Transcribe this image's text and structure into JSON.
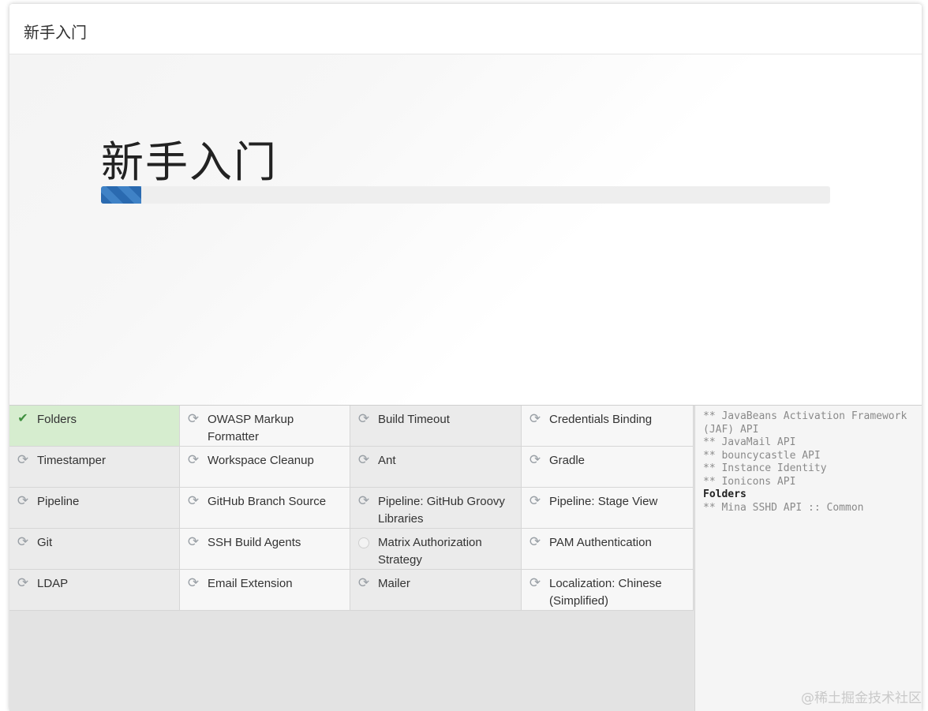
{
  "window": {
    "title": "新手入门"
  },
  "hero": {
    "title": "新手入门",
    "progress_fraction": 0.055,
    "progress_color": "#2a6ab0"
  },
  "plugins": [
    {
      "label": "Folders",
      "status": "success",
      "icon": "check-icon"
    },
    {
      "label": "OWASP Markup Formatter",
      "status": "installing",
      "icon": "sync-icon"
    },
    {
      "label": "Build Timeout",
      "status": "installing",
      "icon": "sync-icon"
    },
    {
      "label": "Credentials Binding",
      "status": "installing",
      "icon": "sync-icon"
    },
    {
      "label": "Timestamper",
      "status": "installing",
      "icon": "sync-icon"
    },
    {
      "label": "Workspace Cleanup",
      "status": "installing",
      "icon": "sync-icon"
    },
    {
      "label": "Ant",
      "status": "installing",
      "icon": "sync-icon"
    },
    {
      "label": "Gradle",
      "status": "installing",
      "icon": "sync-icon"
    },
    {
      "label": "Pipeline",
      "status": "installing",
      "icon": "sync-icon"
    },
    {
      "label": "GitHub Branch Source",
      "status": "installing",
      "icon": "sync-icon"
    },
    {
      "label": "Pipeline: GitHub Groovy Libraries",
      "status": "installing",
      "icon": "sync-icon"
    },
    {
      "label": "Pipeline: Stage View",
      "status": "installing",
      "icon": "sync-icon"
    },
    {
      "label": "Git",
      "status": "installing",
      "icon": "sync-icon"
    },
    {
      "label": "SSH Build Agents",
      "status": "installing",
      "icon": "sync-icon"
    },
    {
      "label": "Matrix Authorization Strategy",
      "status": "pending",
      "icon": "pending-icon"
    },
    {
      "label": "PAM Authentication",
      "status": "installing",
      "icon": "sync-icon"
    },
    {
      "label": "LDAP",
      "status": "installing",
      "icon": "sync-icon"
    },
    {
      "label": "Email Extension",
      "status": "installing",
      "icon": "sync-icon"
    },
    {
      "label": "Mailer",
      "status": "installing",
      "icon": "sync-icon"
    },
    {
      "label": "Localization: Chinese (Simplified)",
      "status": "installing",
      "icon": "sync-icon"
    }
  ],
  "log": {
    "lines": [
      {
        "text": "** JavaBeans Activation Framework (JAF) API",
        "highlight": false
      },
      {
        "text": "** JavaMail API",
        "highlight": false
      },
      {
        "text": "** bouncycastle API",
        "highlight": false
      },
      {
        "text": "** Instance Identity",
        "highlight": false
      },
      {
        "text": "** Ionicons API",
        "highlight": false
      },
      {
        "text": "Folders",
        "highlight": true
      },
      {
        "text": "** Mina SSHD API :: Common",
        "highlight": false
      }
    ]
  },
  "watermark": "@稀土掘金技术社区"
}
